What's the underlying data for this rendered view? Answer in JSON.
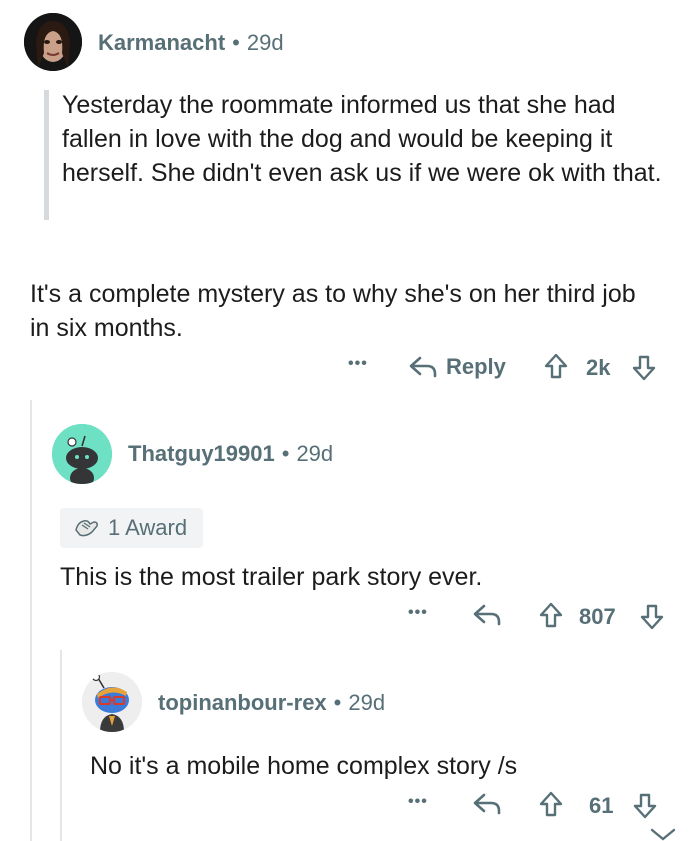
{
  "comments": [
    {
      "author": "Karmanacht",
      "age": "29d",
      "quote": "Yesterday the roommate informed us that she had fallen in love with the dog and would be keeping it herself. She didn't even ask us if we were ok with that.",
      "text": "It's a complete mystery as to why she's on her third job in six months.",
      "reply_label": "Reply",
      "score": "2k",
      "more": "•••"
    },
    {
      "author": "Thatguy19901",
      "age": "29d",
      "award": "1 Award",
      "text": "This is the most trailer park story ever.",
      "score": "807",
      "more": "•••"
    },
    {
      "author": "topinanbour-rex",
      "age": "29d",
      "text": "No it's a mobile home complex story /s",
      "score": "61",
      "more": "•••"
    }
  ],
  "separator": "•",
  "colors": {
    "meta": "#576f76",
    "text": "#1c1c1c",
    "thread_line": "#e4e6e8",
    "avatar_mint": "#6ee0c4"
  }
}
